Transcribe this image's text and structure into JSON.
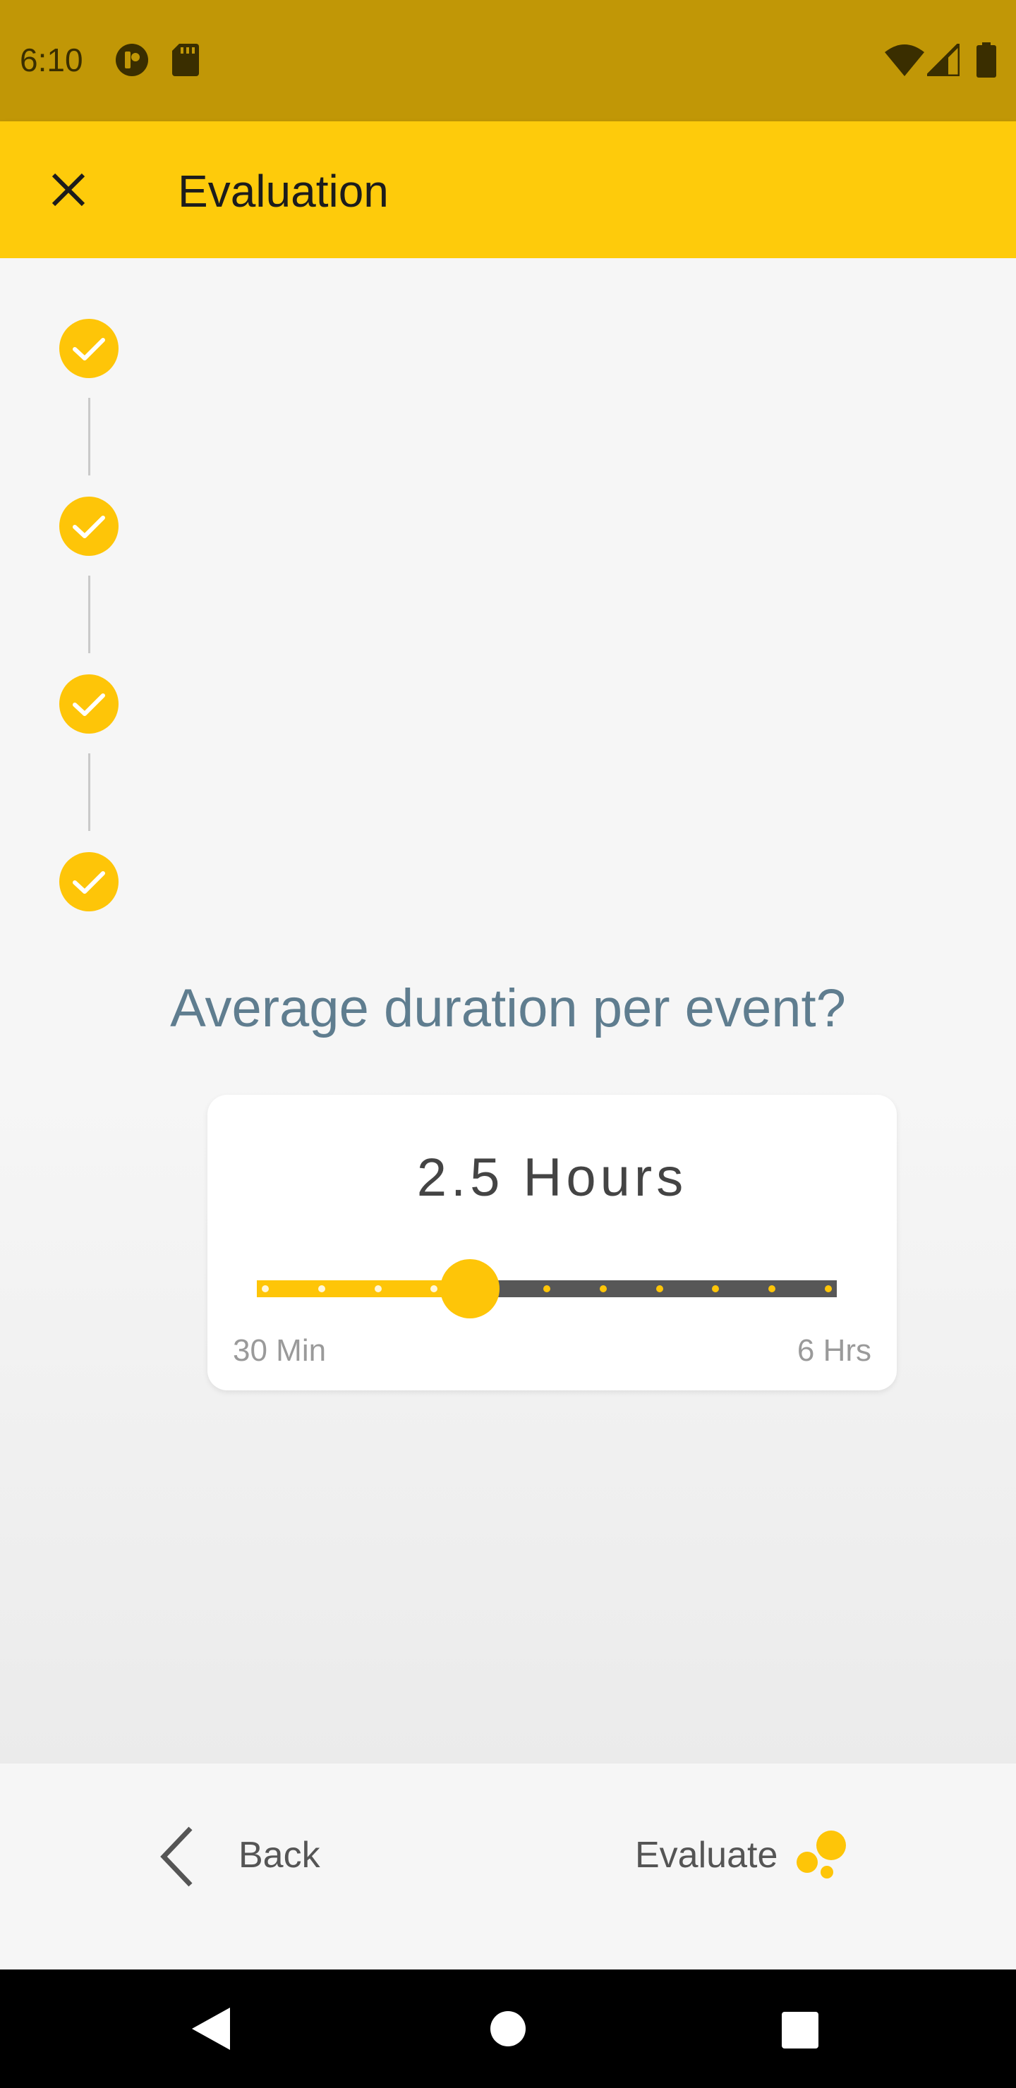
{
  "status_bar": {
    "time": "6:10",
    "icons": [
      "podcast-icon",
      "sd-card-icon",
      "wifi-icon",
      "signal-icon",
      "battery-icon"
    ]
  },
  "app_bar": {
    "title": "Evaluation",
    "close_icon": "close-icon"
  },
  "steps": [
    {
      "state": "completed",
      "icon": "check-icon"
    },
    {
      "state": "completed",
      "icon": "check-icon"
    },
    {
      "state": "completed",
      "icon": "check-icon"
    },
    {
      "state": "completed",
      "icon": "check-icon"
    }
  ],
  "question": "Average duration per event?",
  "slider": {
    "value_label": "2.5 Hours",
    "min_label": "30 Min",
    "max_label": "6 Hrs",
    "value_fraction": 0.3636,
    "step_count": 11,
    "colors": {
      "active": "#fec508",
      "inactive": "#575757"
    }
  },
  "bottom_bar": {
    "back_label": "Back",
    "evaluate_label": "Evaluate",
    "back_icon": "chevron-left-icon",
    "evaluate_icon": "bubbles-icon"
  },
  "nav_bar": {
    "icons": [
      "back-triangle-icon",
      "home-circle-icon",
      "recents-square-icon"
    ]
  },
  "colors": {
    "status_bar": "#c19706",
    "app_bar": "#fecb0b",
    "accent": "#fec508",
    "question_text": "#5f7d8f"
  }
}
